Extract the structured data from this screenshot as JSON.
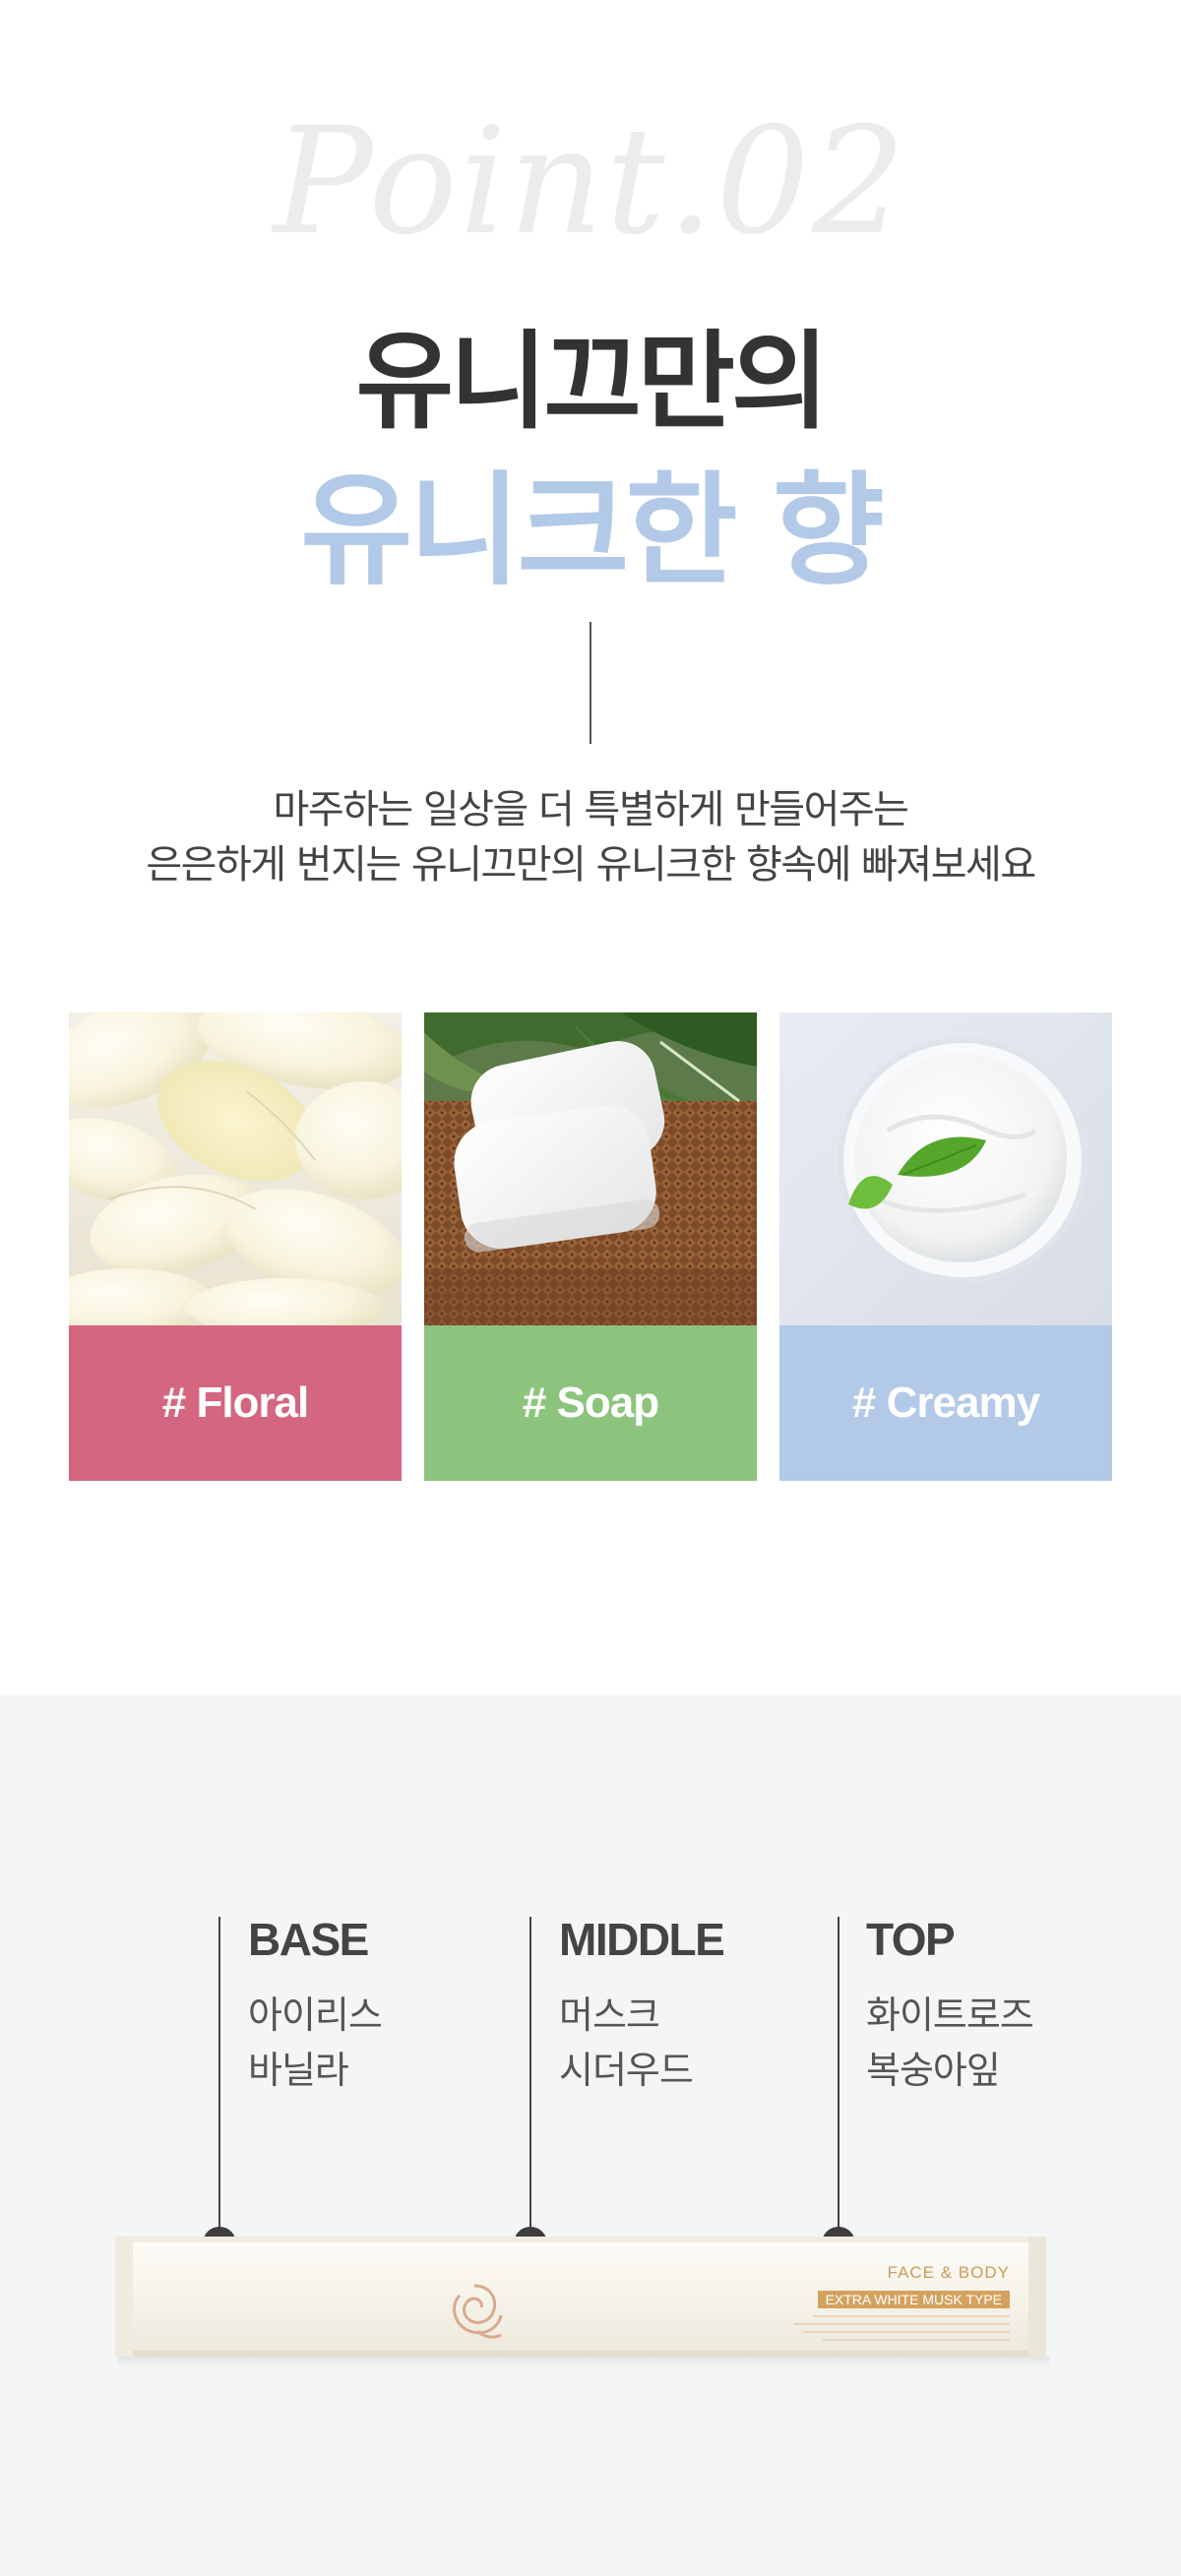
{
  "point": {
    "script_text": "Point.02"
  },
  "headline": {
    "line1": "유니끄만의",
    "line2": "유니크한 향"
  },
  "description": {
    "line1": "마주하는 일상을 더 특별하게 만들어주는",
    "line2": "은은하게 번지는 유니끄만의 유니크한 향속에 빠져보세요"
  },
  "scent_cards": [
    {
      "label": "# Floral",
      "color": "#d4667f",
      "image": "white-rose-petals"
    },
    {
      "label": "# Soap",
      "color": "#8dc47d",
      "image": "white-soap-bars-on-wicker"
    },
    {
      "label": "# Creamy",
      "color": "#b3c9e8",
      "image": "cream-bowl-with-mint-leaf"
    }
  ],
  "notes": {
    "base": {
      "title": "BASE",
      "items": [
        "아이리스",
        "바닐라"
      ]
    },
    "middle": {
      "title": "MIDDLE",
      "items": [
        "머스크",
        "시더우드"
      ]
    },
    "top": {
      "title": "TOP",
      "items": [
        "화이트로즈",
        "복숭아잎"
      ]
    }
  },
  "product": {
    "box_line1": "FACE & BODY",
    "box_line2": "EXTRA WHITE MUSK TYPE",
    "logo": "rose-logo-icon"
  },
  "colors": {
    "headline_dark": "#333333",
    "headline_accent": "#b3c9e8",
    "floral": "#d4667f",
    "soap": "#8dc47d",
    "creamy": "#b3c9e8",
    "bottom_bg": "#f4f5f7"
  }
}
